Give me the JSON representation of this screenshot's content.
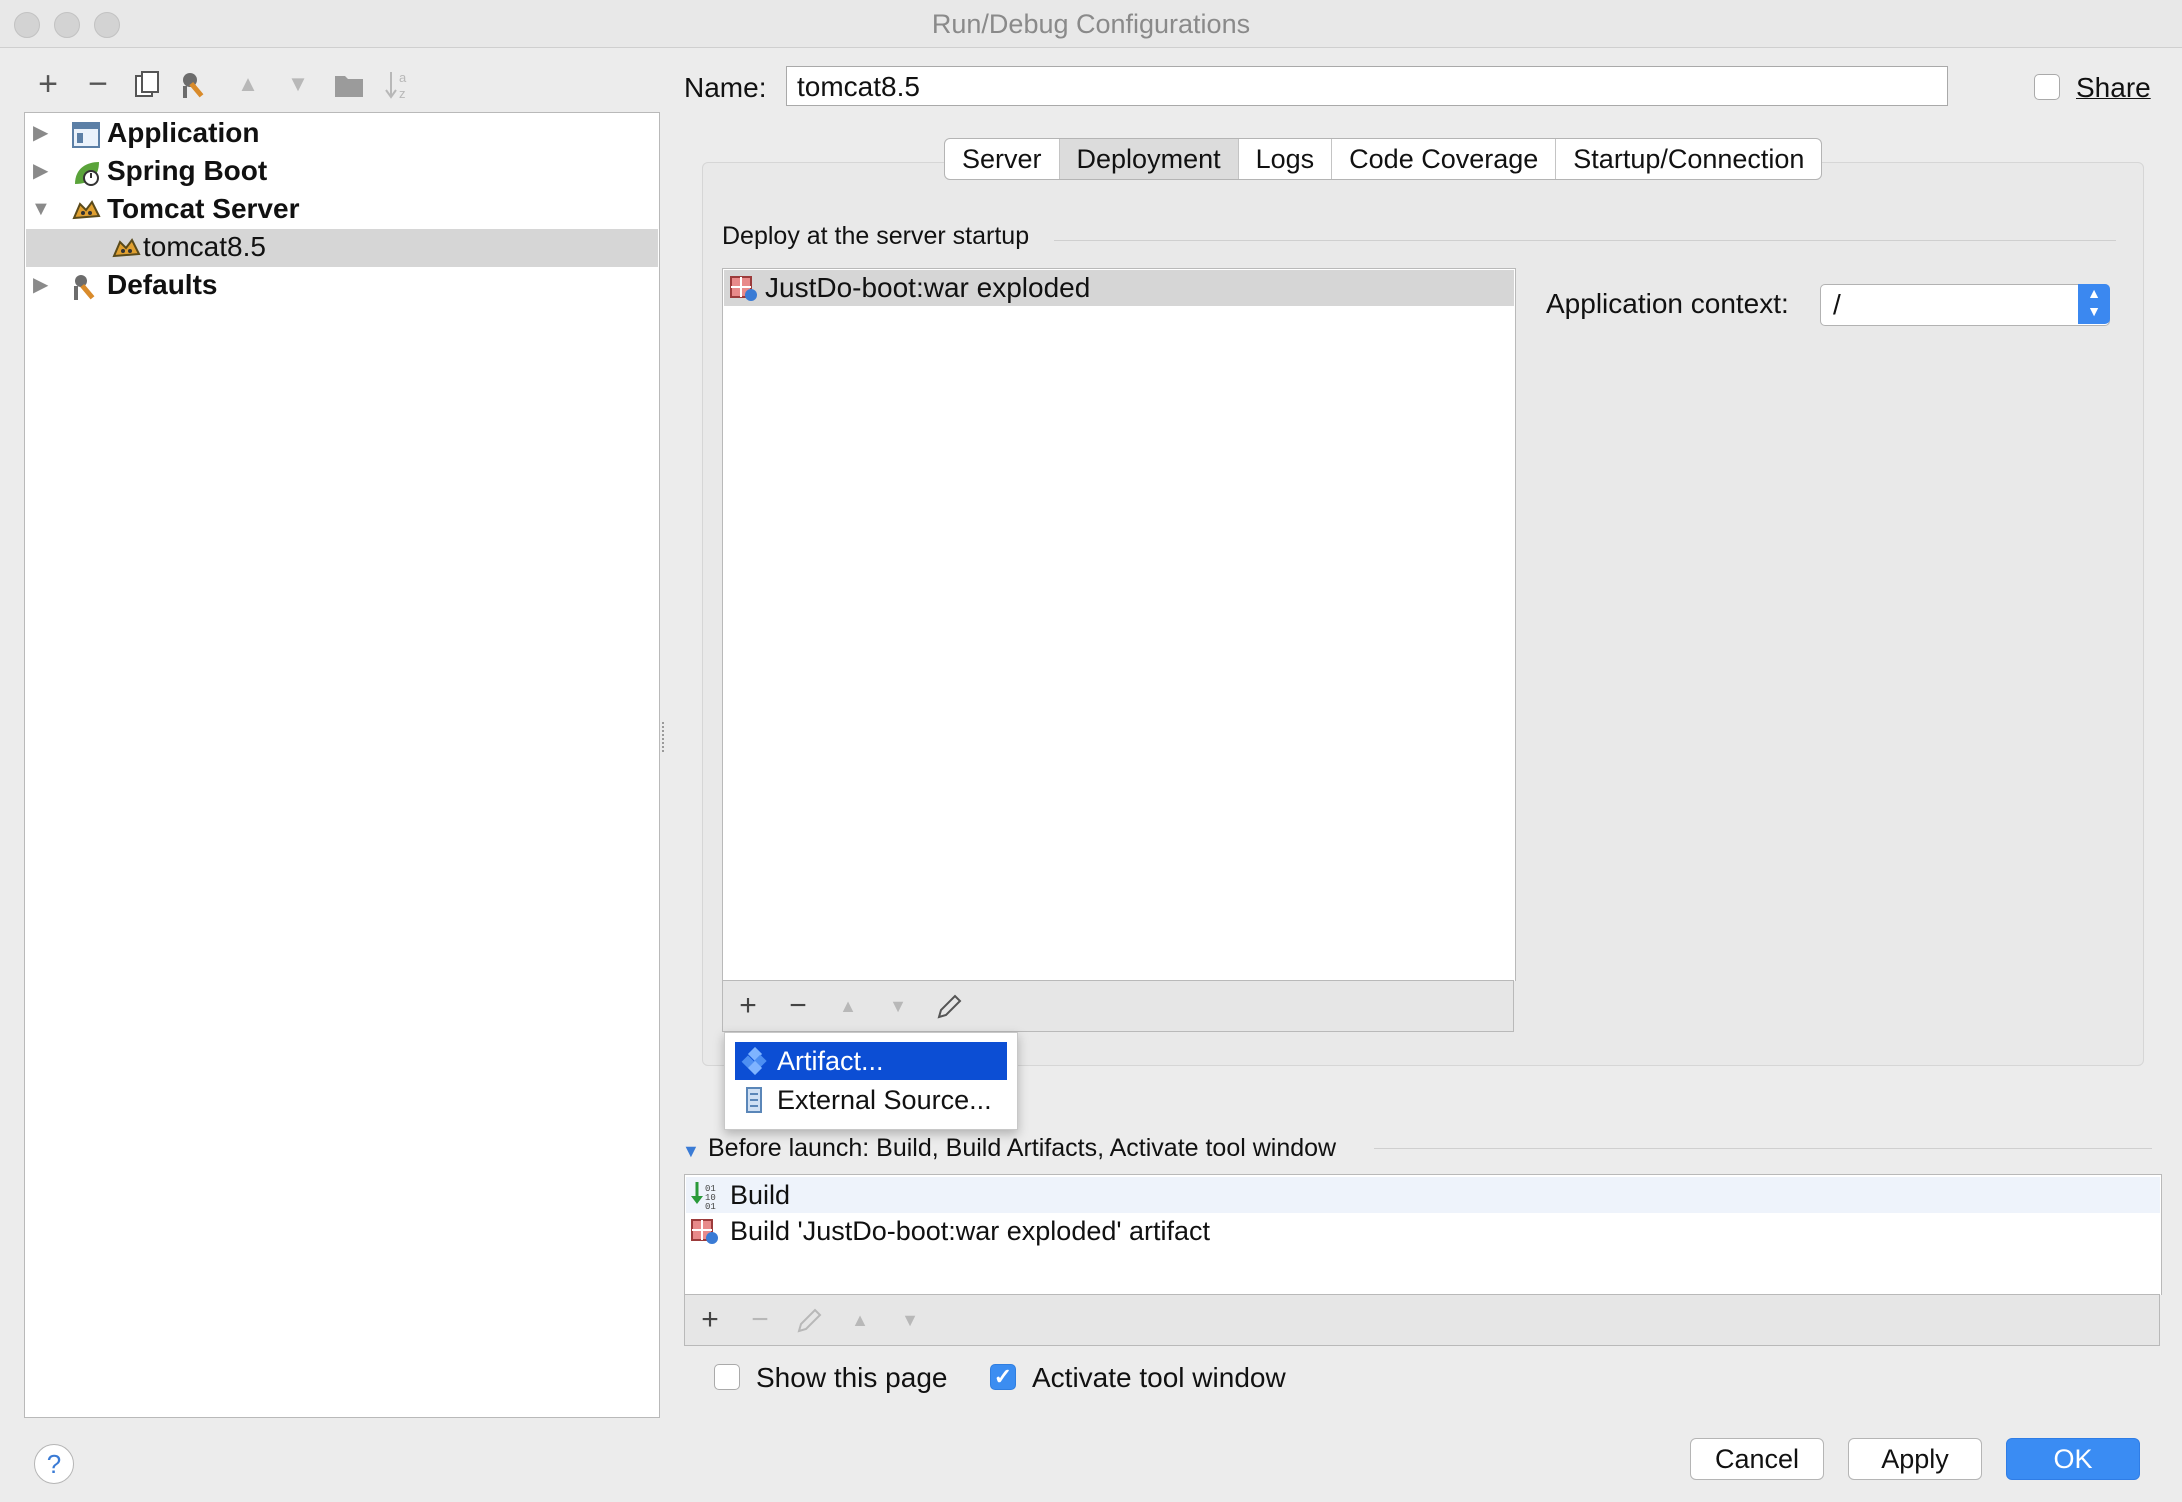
{
  "window": {
    "title": "Run/Debug Configurations"
  },
  "sidebar": {
    "toolbar": [
      "add-icon",
      "remove-icon",
      "copy-icon",
      "edit-defaults-icon",
      "move-up-icon",
      "move-down-icon",
      "folder-icon",
      "sort-icon"
    ],
    "items": [
      {
        "label": "Application",
        "icon": "application-icon",
        "expanded": false
      },
      {
        "label": "Spring Boot",
        "icon": "spring-boot-icon",
        "expanded": false
      },
      {
        "label": "Tomcat Server",
        "icon": "tomcat-icon",
        "expanded": true
      },
      {
        "label": "tomcat8.5",
        "icon": "tomcat-icon",
        "selected": true
      },
      {
        "label": "Defaults",
        "icon": "wrench-icon",
        "expanded": false
      }
    ]
  },
  "form": {
    "name_label": "Name:",
    "name_value": "tomcat8.5",
    "share_label": "Share",
    "share_checked": false
  },
  "tabs": [
    {
      "label": "Server"
    },
    {
      "label": "Deployment",
      "active": true
    },
    {
      "label": "Logs"
    },
    {
      "label": "Code Coverage"
    },
    {
      "label": "Startup/Connection"
    }
  ],
  "deployment": {
    "group_title": "Deploy at the server startup",
    "items": [
      {
        "label": "JustDo-boot:war exploded",
        "selected": true
      }
    ],
    "app_context_label": "Application context:",
    "app_context_value": "/",
    "add_menu": [
      {
        "label": "Artifact...",
        "active": true
      },
      {
        "label": "External Source..."
      }
    ]
  },
  "before_launch": {
    "title": "Before launch: Build, Build Artifacts, Activate tool window",
    "items": [
      {
        "label": "Build"
      },
      {
        "label": "Build 'JustDo-boot:war exploded' artifact"
      }
    ],
    "show_page_label": "Show this page",
    "show_page_checked": false,
    "activate_label": "Activate tool window",
    "activate_checked": true
  },
  "buttons": {
    "cancel": "Cancel",
    "apply": "Apply",
    "ok": "OK",
    "help": "?"
  },
  "colors": {
    "accent": "#3a8cf3",
    "menu_highlight": "#0c4ed4",
    "selection": "#d6d6d6"
  }
}
